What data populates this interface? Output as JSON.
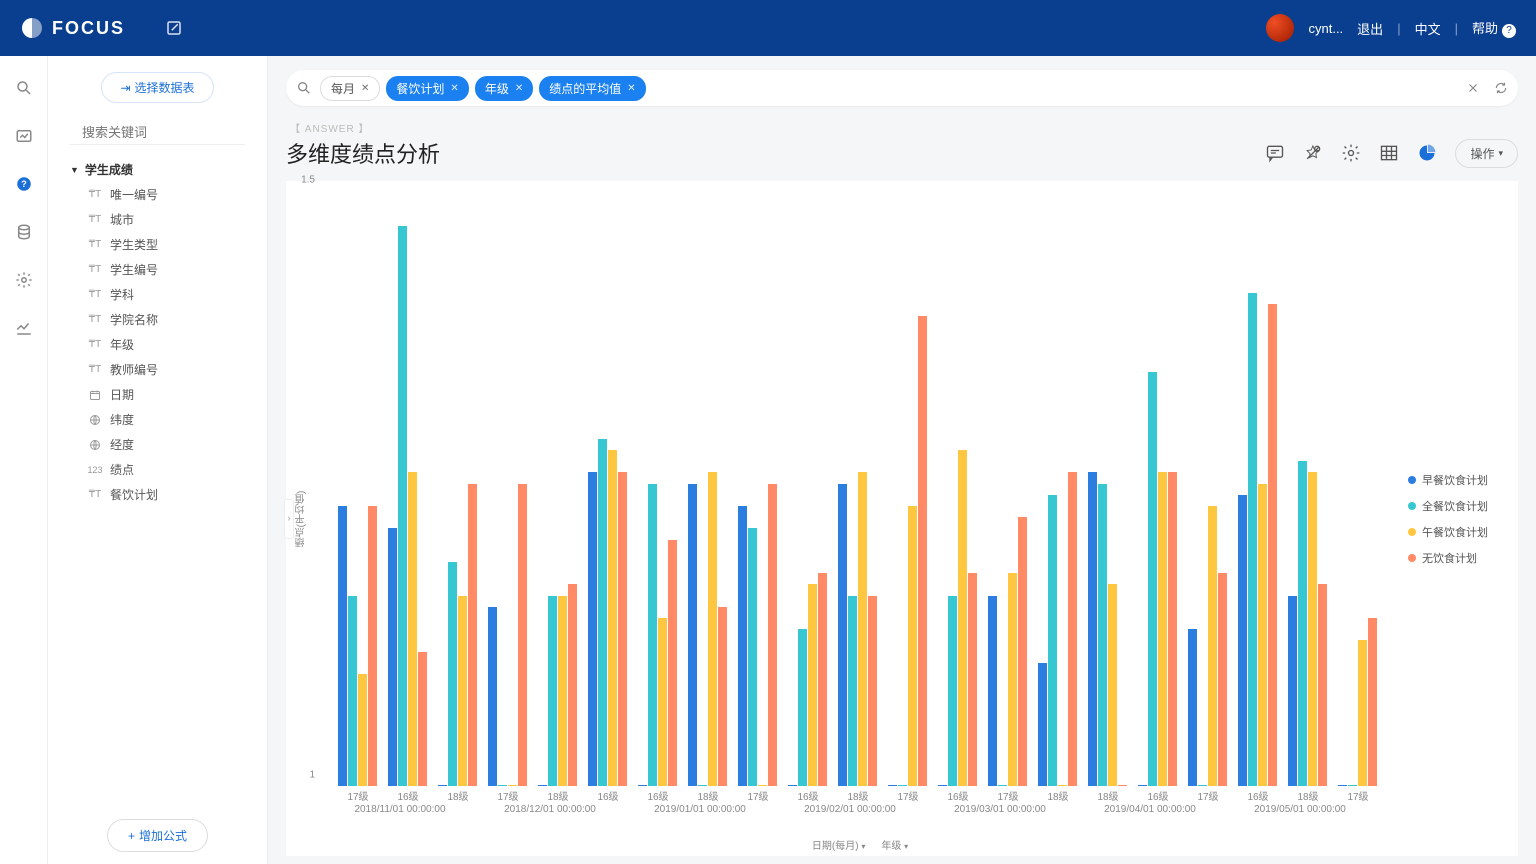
{
  "brand": "FOCUS",
  "top": {
    "user": "cynt...",
    "logout": "退出",
    "lang": "中文",
    "help": "帮助"
  },
  "side": {
    "select_ds": "选择数据表",
    "kw_placeholder": "搜索关键词",
    "root": "学生成绩",
    "items": [
      {
        "icon": "T",
        "label": "唯一编号"
      },
      {
        "icon": "T",
        "label": "城市"
      },
      {
        "icon": "T",
        "label": "学生类型"
      },
      {
        "icon": "T",
        "label": "学生编号"
      },
      {
        "icon": "T",
        "label": "学科"
      },
      {
        "icon": "T",
        "label": "学院名称"
      },
      {
        "icon": "T",
        "label": "年级"
      },
      {
        "icon": "T",
        "label": "教师编号"
      },
      {
        "icon": "cal",
        "label": "日期"
      },
      {
        "icon": "geo",
        "label": "纬度"
      },
      {
        "icon": "geo",
        "label": "经度"
      },
      {
        "icon": "123",
        "label": "绩点"
      },
      {
        "icon": "T",
        "label": "餐饮计划"
      }
    ],
    "add_formula": "增加公式"
  },
  "query": {
    "tags": [
      {
        "label": "每月",
        "kind": "plain"
      },
      {
        "label": "餐饮计划",
        "kind": "blue"
      },
      {
        "label": "年级",
        "kind": "blue"
      },
      {
        "label": "绩点的平均值",
        "kind": "blue"
      }
    ]
  },
  "answer_label": "【 ANSWER 】",
  "title": "多维度绩点分析",
  "op_btn": "操作",
  "legend": [
    "早餐饮食计划",
    "全餐饮食计划",
    "午餐饮食计划",
    "无饮食计划"
  ],
  "x_controls": {
    "a": "日期(每月)",
    "b": "年级"
  },
  "chart_data": {
    "type": "bar",
    "ylabel": "绩点(平均值)",
    "ylim": [
      1,
      1.5
    ],
    "yticks": [
      1,
      1.5
    ],
    "months": [
      "2018/11/01 00:00:00",
      "2018/12/01 00:00:00",
      "2019/01/01 00:00:00",
      "2019/02/01 00:00:00",
      "2019/03/01 00:00:00",
      "2019/04/01 00:00:00",
      "2019/05/01 00:00:00"
    ],
    "grades_per_month": [
      [
        "17级",
        "16级",
        "18级"
      ],
      [
        "17级",
        "18级",
        "16级"
      ],
      [
        "16级",
        "18级",
        "17级"
      ],
      [
        "16级",
        "18级",
        "17级"
      ],
      [
        "16级",
        "17级",
        "18级"
      ],
      [
        "18级",
        "16级",
        "17级"
      ],
      [
        "16级",
        "18级",
        "17级"
      ]
    ],
    "series_names": [
      "早餐饮食计划",
      "全餐饮食计划",
      "午餐饮食计划",
      "无饮食计划"
    ],
    "values": [
      [
        [
          1.25,
          1.17,
          1.1,
          1.25
        ],
        [
          1.23,
          1.5,
          1.28,
          1.12
        ],
        [
          1.0,
          1.2,
          1.17,
          1.27
        ]
      ],
      [
        [
          1.16,
          1.0,
          1.0,
          1.27
        ],
        [
          1.0,
          1.17,
          1.17,
          1.18
        ],
        [
          1.28,
          1.31,
          1.3,
          1.28
        ]
      ],
      [
        [
          1.0,
          1.27,
          1.15,
          1.22
        ],
        [
          1.27,
          1.0,
          1.28,
          1.16
        ],
        [
          1.25,
          1.23,
          1.0,
          1.27
        ]
      ],
      [
        [
          1.0,
          1.14,
          1.18,
          1.19
        ],
        [
          1.27,
          1.17,
          1.28,
          1.17
        ],
        [
          1.0,
          1.0,
          1.25,
          1.42
        ]
      ],
      [
        [
          1.0,
          1.17,
          1.3,
          1.19
        ],
        [
          1.17,
          1.0,
          1.19,
          1.24
        ],
        [
          1.11,
          1.26,
          1.0,
          1.28
        ]
      ],
      [
        [
          1.28,
          1.27,
          1.18,
          1.0
        ],
        [
          1.0,
          1.37,
          1.28,
          1.28
        ],
        [
          1.14,
          1.0,
          1.25,
          1.19
        ]
      ],
      [
        [
          1.26,
          1.44,
          1.27,
          1.43
        ],
        [
          1.17,
          1.29,
          1.28,
          1.18
        ],
        [
          1.0,
          1.0,
          1.13,
          1.15
        ]
      ]
    ]
  }
}
